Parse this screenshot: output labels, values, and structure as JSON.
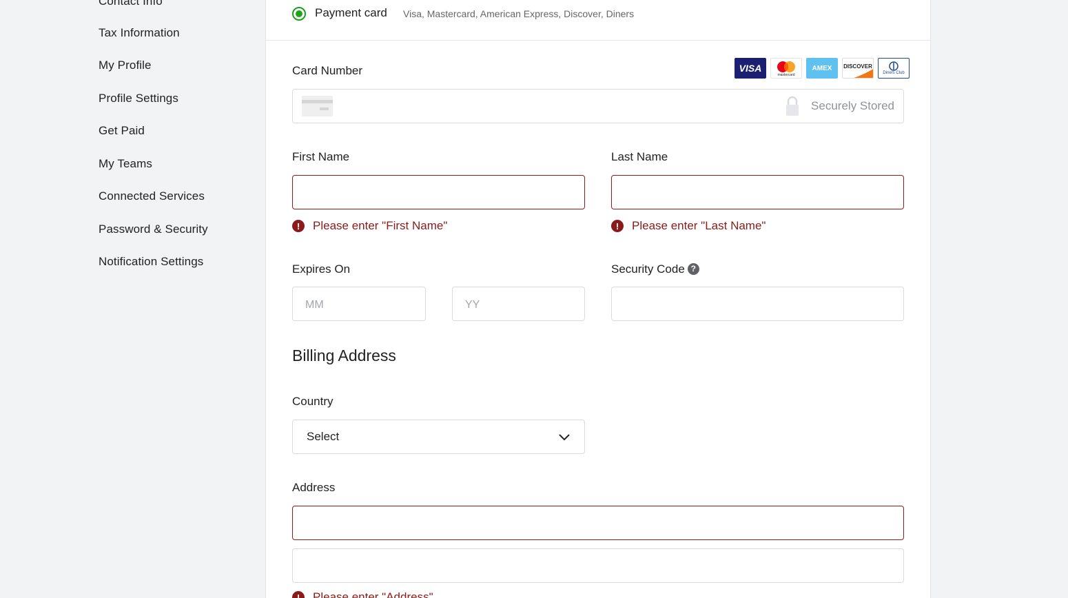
{
  "sidebar": {
    "items": [
      {
        "label": "Contact Info"
      },
      {
        "label": "Tax Information"
      },
      {
        "label": "My Profile"
      },
      {
        "label": "Profile Settings"
      },
      {
        "label": "Get Paid"
      },
      {
        "label": "My Teams"
      },
      {
        "label": "Connected Services"
      },
      {
        "label": "Password & Security"
      },
      {
        "label": "Notification Settings"
      }
    ]
  },
  "payment_method": {
    "label": "Payment card",
    "description": "Visa, Mastercard, American Express, Discover, Diners",
    "selected": true,
    "accent": "#1fa31f"
  },
  "card_number": {
    "label": "Card Number",
    "value": "",
    "secure_text": "Securely Stored",
    "logos": [
      "visa-logo",
      "mastercard-logo",
      "amex-logo",
      "discover-logo",
      "diners-club-logo"
    ],
    "logo_text": {
      "visa": "VISA",
      "mastercard": "mastercard",
      "amex": "AMEX",
      "discover": "DISCOVER",
      "diners": "Diners Club"
    }
  },
  "first_name": {
    "label": "First Name",
    "value": "",
    "error": "Please enter \"First Name\""
  },
  "last_name": {
    "label": "Last Name",
    "value": "",
    "error": "Please enter \"Last Name\""
  },
  "expires": {
    "label": "Expires On",
    "month_placeholder": "MM",
    "year_placeholder": "YY"
  },
  "security_code": {
    "label": "Security Code",
    "help": "?"
  },
  "billing": {
    "title": "Billing Address",
    "country_label": "Country",
    "country_value": "Select",
    "address_label": "Address",
    "address_line1": "",
    "address_line2": "",
    "address_error": "Please enter \"Address\""
  },
  "colors": {
    "error": "#8b1a1a",
    "border": "#d8dade",
    "background": "#f2f3f5"
  }
}
